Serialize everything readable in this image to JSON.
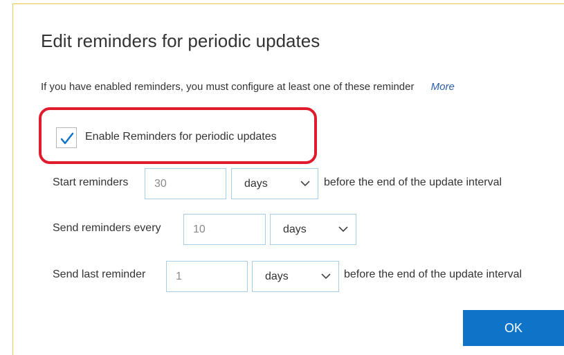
{
  "dialog": {
    "title": "Edit reminders for periodic updates",
    "intro": "If you have enabled reminders, you must configure at least one of these reminder",
    "more_link": "More"
  },
  "enable_reminders": {
    "checked": true,
    "label": "Enable Reminders for periodic updates"
  },
  "start_reminders": {
    "label": "Start reminders",
    "value": "30",
    "unit": "days",
    "suffix": "before the end of the update interval"
  },
  "send_every": {
    "label": "Send reminders every",
    "value": "10",
    "unit": "days"
  },
  "send_last": {
    "label": "Send last reminder",
    "value": "1",
    "unit": "days",
    "suffix": "before the end of the update interval"
  },
  "buttons": {
    "ok": "OK"
  },
  "colors": {
    "accent": "#0f74c7",
    "highlight": "#e01b2d",
    "input_border": "#a8cde6",
    "frame_border": "#e9c94a"
  }
}
